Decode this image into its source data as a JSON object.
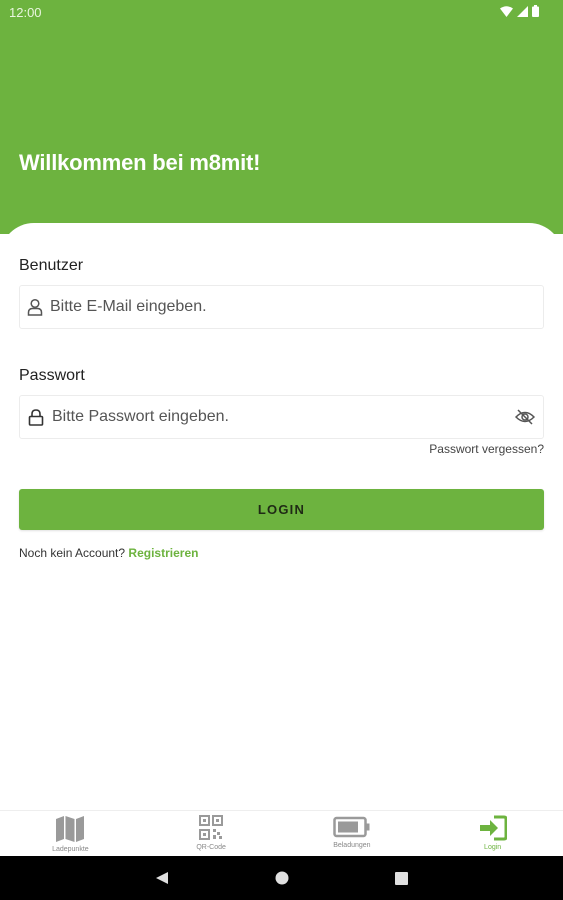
{
  "status_bar": {
    "time": "12:00"
  },
  "header": {
    "title": "Willkommen bei m8mit!"
  },
  "form": {
    "user_label": "Benutzer",
    "user_placeholder": "Bitte E-Mail eingeben.",
    "password_label": "Passwort",
    "password_placeholder": "Bitte Passwort eingeben.",
    "forgot_password": "Passwort vergessen?",
    "login_button": "LOGIN",
    "no_account_text": "Noch kein Account?",
    "register_link": "Registrieren"
  },
  "bottom_nav": {
    "items": [
      {
        "label": "Ladepunkte",
        "icon": "map-icon",
        "active": false
      },
      {
        "label": "QR-Code",
        "icon": "qr-code-icon",
        "active": false
      },
      {
        "label": "Beladungen",
        "icon": "battery-icon",
        "active": false
      },
      {
        "label": "Login",
        "icon": "login-icon",
        "active": true
      }
    ]
  },
  "colors": {
    "brand_green": "#6db33f",
    "inactive_icon": "#999999"
  }
}
